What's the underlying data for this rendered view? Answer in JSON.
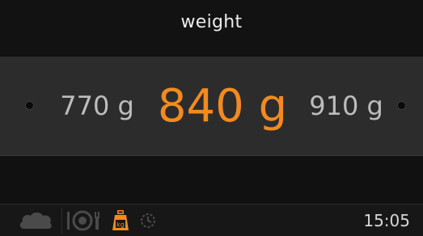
{
  "header": {
    "title": "weight"
  },
  "selector": {
    "previous": "770 g",
    "current": "840 g",
    "next": "910 g"
  },
  "footer": {
    "icons": [
      "cloud-icon",
      "plate-cutlery-icon",
      "kg-weight-icon",
      "timer-icon"
    ],
    "time": "15:05"
  },
  "colors": {
    "accent": "#f48a1e",
    "background": "#101010",
    "selector_band": "#2c2c2c",
    "secondary_text": "#bdbdbd"
  }
}
